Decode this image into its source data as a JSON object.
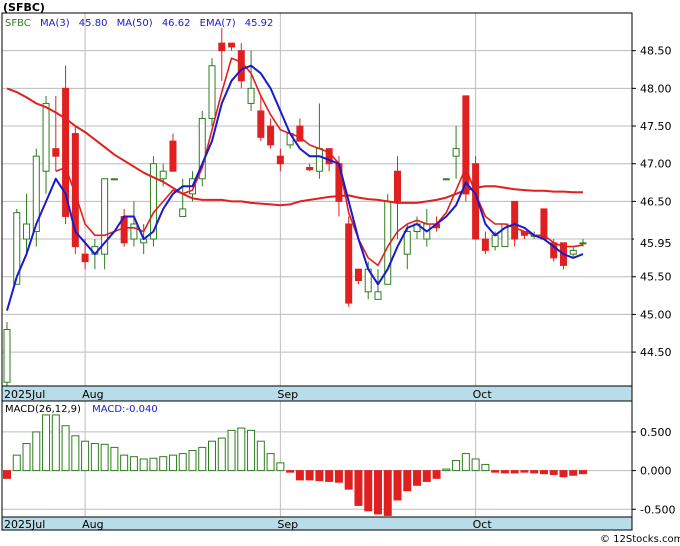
{
  "title": "(SFBC)",
  "watermark": "© 12Stocks.com",
  "colors": {
    "up": "#2e7d1e",
    "down": "#e02020",
    "ma_fast": "#1a1acc",
    "ma_slow": "#e02020",
    "axis_band": "#b8dde8",
    "grid": "#bcbcbc"
  },
  "chart_data": [
    {
      "type": "candlestick",
      "legend": {
        "ticker": "SFBC",
        "entries": [
          {
            "label": "MA(3)",
            "value": "45.80",
            "color": "#1a1acc"
          },
          {
            "label": "MA(50)",
            "value": "46.62",
            "color": "#e02020"
          },
          {
            "label": "EMA(7)",
            "value": "45.92",
            "color": "#e02020"
          }
        ]
      },
      "last_price_label": "45.95",
      "y_ticks": [
        "48.50",
        "48.00",
        "47.50",
        "47.00",
        "46.50",
        "46.00",
        "45.50",
        "45.00",
        "44.50"
      ],
      "ylim": [
        44.05,
        49.0
      ],
      "x_labels": [
        {
          "label": "2025Jul",
          "index": 0
        },
        {
          "label": "Aug",
          "index": 8
        },
        {
          "label": "Sep",
          "index": 28
        },
        {
          "label": "Oct",
          "index": 48
        }
      ],
      "grid": true,
      "ohlc": [
        [
          44.1,
          44.9,
          44.05,
          44.8
        ],
        [
          45.4,
          46.4,
          45.4,
          46.35
        ],
        [
          46.0,
          46.6,
          45.8,
          46.2
        ],
        [
          46.1,
          47.2,
          45.9,
          47.1
        ],
        [
          46.9,
          47.9,
          46.6,
          47.8
        ],
        [
          47.2,
          47.9,
          46.9,
          47.1
        ],
        [
          48.0,
          48.3,
          46.2,
          46.3
        ],
        [
          47.4,
          47.5,
          45.8,
          45.9
        ],
        [
          45.8,
          46.0,
          45.6,
          45.7
        ],
        [
          45.8,
          46.0,
          45.6,
          45.9
        ],
        [
          45.8,
          46.8,
          45.6,
          46.8
        ],
        [
          46.8,
          46.8,
          46.8,
          46.8
        ],
        [
          46.3,
          46.4,
          45.9,
          45.95
        ],
        [
          46.0,
          46.5,
          45.9,
          46.2
        ],
        [
          45.95,
          46.2,
          45.8,
          46.0
        ],
        [
          46.0,
          47.1,
          45.9,
          47.0
        ],
        [
          46.8,
          47.0,
          46.7,
          46.9
        ],
        [
          47.3,
          47.4,
          46.9,
          46.9
        ],
        [
          46.3,
          46.8,
          46.3,
          46.4
        ],
        [
          46.6,
          46.9,
          46.5,
          46.8
        ],
        [
          46.8,
          47.7,
          46.7,
          47.6
        ],
        [
          47.6,
          48.4,
          47.5,
          48.3
        ],
        [
          48.6,
          48.8,
          48.1,
          48.5
        ],
        [
          48.6,
          48.6,
          48.5,
          48.55
        ],
        [
          48.5,
          48.6,
          48.0,
          48.1
        ],
        [
          47.8,
          48.5,
          47.7,
          48.0
        ],
        [
          47.7,
          47.9,
          47.3,
          47.35
        ],
        [
          47.5,
          47.6,
          47.2,
          47.25
        ],
        [
          47.1,
          47.2,
          46.9,
          47.0
        ],
        [
          47.25,
          47.4,
          47.2,
          47.4
        ],
        [
          47.5,
          47.6,
          47.3,
          47.3
        ],
        [
          46.95,
          47.0,
          46.9,
          46.92
        ],
        [
          46.9,
          47.8,
          46.8,
          47.2
        ],
        [
          47.2,
          47.2,
          46.9,
          47.0
        ],
        [
          47.0,
          47.1,
          46.3,
          46.5
        ],
        [
          46.2,
          46.3,
          45.1,
          45.15
        ],
        [
          45.6,
          45.6,
          45.4,
          45.45
        ],
        [
          45.3,
          45.7,
          45.2,
          45.6
        ],
        [
          45.2,
          45.6,
          45.2,
          45.3
        ],
        [
          45.4,
          46.6,
          45.4,
          46.5
        ],
        [
          46.9,
          47.1,
          46.0,
          46.5
        ],
        [
          45.8,
          46.2,
          45.6,
          46.1
        ],
        [
          46.1,
          46.3,
          46.0,
          46.2
        ],
        [
          46.0,
          46.4,
          45.9,
          46.2
        ],
        [
          46.2,
          46.3,
          46.1,
          46.15
        ],
        [
          46.8,
          46.8,
          46.8,
          46.8
        ],
        [
          47.1,
          47.5,
          46.8,
          47.2
        ],
        [
          47.9,
          47.9,
          46.5,
          46.6
        ],
        [
          47.0,
          47.1,
          46.0,
          46.0
        ],
        [
          46.0,
          46.1,
          45.8,
          45.85
        ],
        [
          45.9,
          46.1,
          45.85,
          46.05
        ],
        [
          45.9,
          46.2,
          45.9,
          46.2
        ],
        [
          46.5,
          46.5,
          45.9,
          46.0
        ],
        [
          46.1,
          46.1,
          46.0,
          46.05
        ],
        [
          46.05,
          46.1,
          46.0,
          46.05
        ],
        [
          46.4,
          46.4,
          46.0,
          46.0
        ],
        [
          45.95,
          46.0,
          45.7,
          45.75
        ],
        [
          45.95,
          45.95,
          45.6,
          45.65
        ],
        [
          45.8,
          45.9,
          45.75,
          45.85
        ],
        [
          45.95,
          46.0,
          45.9,
          45.95
        ]
      ],
      "ma3": [
        45.05,
        45.5,
        45.8,
        46.2,
        46.5,
        46.8,
        46.6,
        46.1,
        45.95,
        45.8,
        45.95,
        46.1,
        46.3,
        46.3,
        46.0,
        46.1,
        46.4,
        46.6,
        46.7,
        46.7,
        47.0,
        47.3,
        47.8,
        48.1,
        48.25,
        48.3,
        48.2,
        48.0,
        47.7,
        47.4,
        47.2,
        47.1,
        47.1,
        47.05,
        47.0,
        46.5,
        46.0,
        45.6,
        45.4,
        45.6,
        45.9,
        46.15,
        46.2,
        46.1,
        46.2,
        46.3,
        46.45,
        46.75,
        46.6,
        46.2,
        46.05,
        46.15,
        46.2,
        46.15,
        46.05,
        46.0,
        45.9,
        45.8,
        45.75,
        45.8
      ],
      "ema7": [
        null,
        null,
        null,
        null,
        null,
        46.9,
        46.95,
        46.6,
        46.2,
        46.05,
        46.05,
        46.1,
        46.15,
        46.15,
        46.1,
        46.35,
        46.5,
        46.65,
        46.6,
        46.65,
        46.95,
        47.45,
        47.95,
        48.4,
        48.35,
        48.2,
        47.9,
        47.65,
        47.45,
        47.4,
        47.35,
        47.25,
        47.2,
        47.15,
        47.0,
        46.35,
        46.0,
        45.75,
        45.65,
        45.9,
        46.1,
        46.2,
        46.25,
        46.2,
        46.2,
        46.35,
        46.65,
        46.95,
        46.6,
        46.3,
        46.2,
        46.2,
        46.15,
        46.1,
        46.05,
        46.05,
        45.95,
        45.9,
        45.9,
        45.92
      ],
      "ma50": [
        48.0,
        47.95,
        47.88,
        47.8,
        47.75,
        47.68,
        47.6,
        47.5,
        47.42,
        47.32,
        47.22,
        47.12,
        47.04,
        46.96,
        46.88,
        46.82,
        46.76,
        46.68,
        46.6,
        46.54,
        46.52,
        46.52,
        46.52,
        46.5,
        46.5,
        46.48,
        46.47,
        46.46,
        46.45,
        46.46,
        46.5,
        46.52,
        46.54,
        46.56,
        46.57,
        46.58,
        46.55,
        46.53,
        46.52,
        46.5,
        46.48,
        46.48,
        46.48,
        46.5,
        46.52,
        46.55,
        46.6,
        46.65,
        46.68,
        46.7,
        46.7,
        46.68,
        46.66,
        46.65,
        46.64,
        46.64,
        46.63,
        46.63,
        46.62,
        46.62
      ]
    },
    {
      "type": "bar",
      "legend": {
        "entries": [
          {
            "label": "MACD(26,12,9)",
            "color": "#000000"
          },
          {
            "label": "MACD:-0.040",
            "color": "#1a1acc"
          }
        ]
      },
      "y_ticks": [
        "0.500",
        "0.000",
        "-0.500"
      ],
      "ylim": [
        -0.6,
        0.9
      ],
      "x_labels": [
        {
          "label": "2025Jul",
          "index": 0
        },
        {
          "label": "Aug",
          "index": 8
        },
        {
          "label": "Sep",
          "index": 28
        },
        {
          "label": "Oct",
          "index": 48
        }
      ],
      "values": [
        -0.1,
        0.2,
        0.35,
        0.5,
        0.72,
        0.72,
        0.58,
        0.45,
        0.38,
        0.35,
        0.34,
        0.3,
        0.2,
        0.18,
        0.15,
        0.16,
        0.18,
        0.2,
        0.22,
        0.26,
        0.3,
        0.38,
        0.42,
        0.52,
        0.55,
        0.52,
        0.38,
        0.22,
        0.1,
        -0.02,
        -0.12,
        -0.12,
        -0.13,
        -0.14,
        -0.15,
        -0.24,
        -0.45,
        -0.52,
        -0.56,
        -0.58,
        -0.38,
        -0.26,
        -0.19,
        -0.14,
        -0.1,
        0.02,
        0.13,
        0.22,
        0.15,
        0.08,
        -0.02,
        -0.03,
        -0.03,
        -0.02,
        -0.03,
        -0.04,
        -0.05,
        -0.08,
        -0.06,
        -0.04
      ]
    }
  ]
}
